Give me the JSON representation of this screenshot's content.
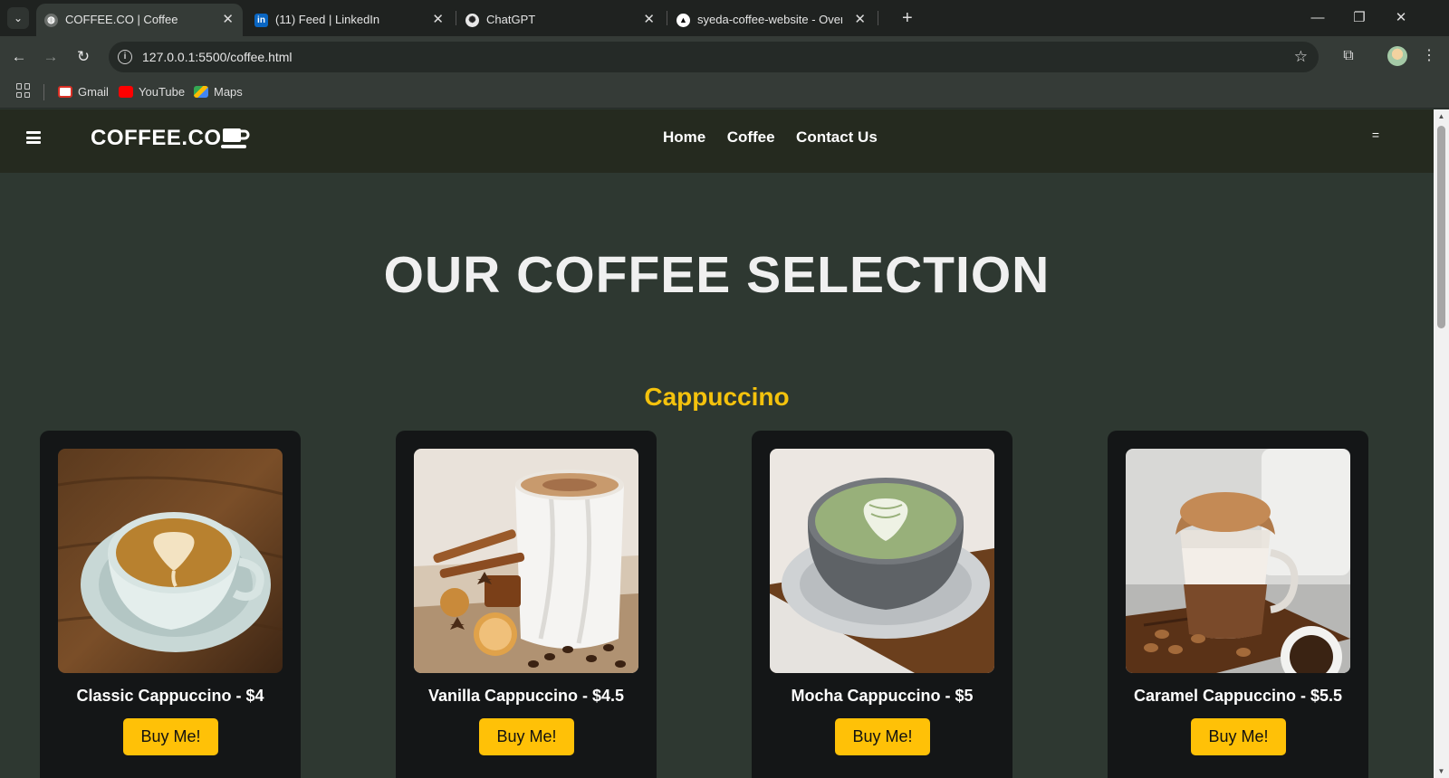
{
  "browser": {
    "tabs": [
      {
        "title": "COFFEE.CO | Coffee",
        "active": true
      },
      {
        "title": "(11) Feed | LinkedIn",
        "active": false
      },
      {
        "title": "ChatGPT",
        "active": false
      },
      {
        "title": "syeda-coffee-website - Overview",
        "active": false
      }
    ],
    "url": "127.0.0.1:5500/coffee.html",
    "bookmarks": [
      "Gmail",
      "YouTube",
      "Maps"
    ]
  },
  "site": {
    "brand": "COFFEE.CO",
    "nav": [
      "Home",
      "Coffee",
      "Contact Us"
    ],
    "menu_glyph": "=",
    "page_title": "OUR COFFEE SELECTION",
    "section_title": "Cappuccino",
    "products": [
      {
        "name": "Classic Cappuccino - $4",
        "button": "Buy Me!"
      },
      {
        "name": "Vanilla Cappuccino - $4.5",
        "button": "Buy Me!"
      },
      {
        "name": "Mocha Cappuccino - $5",
        "button": "Buy Me!"
      },
      {
        "name": "Caramel Cappuccino - $5.5",
        "button": "Buy Me!"
      }
    ]
  },
  "colors": {
    "page_bg": "#2e3831",
    "header_bg": "#252a1f",
    "accent": "#f4c20d",
    "button": "#ffc107",
    "card_bg": "#141617"
  }
}
